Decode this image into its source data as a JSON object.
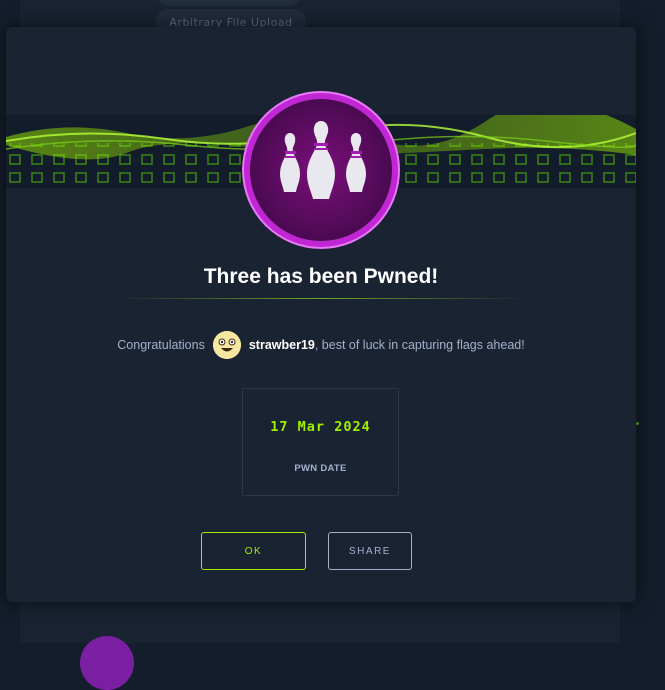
{
  "background": {
    "tag_label": "Arbitrary File Upload"
  },
  "modal": {
    "title": "Three has been Pwned!",
    "congrats_prefix": "Congratulations",
    "username": "strawber19",
    "congrats_suffix": ", best of luck in capturing flags ahead!",
    "pwn_date": "17 Mar 2024",
    "pwn_date_label": "PWN DATE",
    "ok_button": "OK",
    "share_button": "SHARE"
  },
  "colors": {
    "accent_green": "#9fef00",
    "logo_ring": "#c026d3",
    "background": "#141d2b",
    "panel": "#1a2332"
  },
  "icons": {
    "machine_logo": "bowling-pins-icon",
    "user_avatar": "emoji-avatar-icon"
  }
}
